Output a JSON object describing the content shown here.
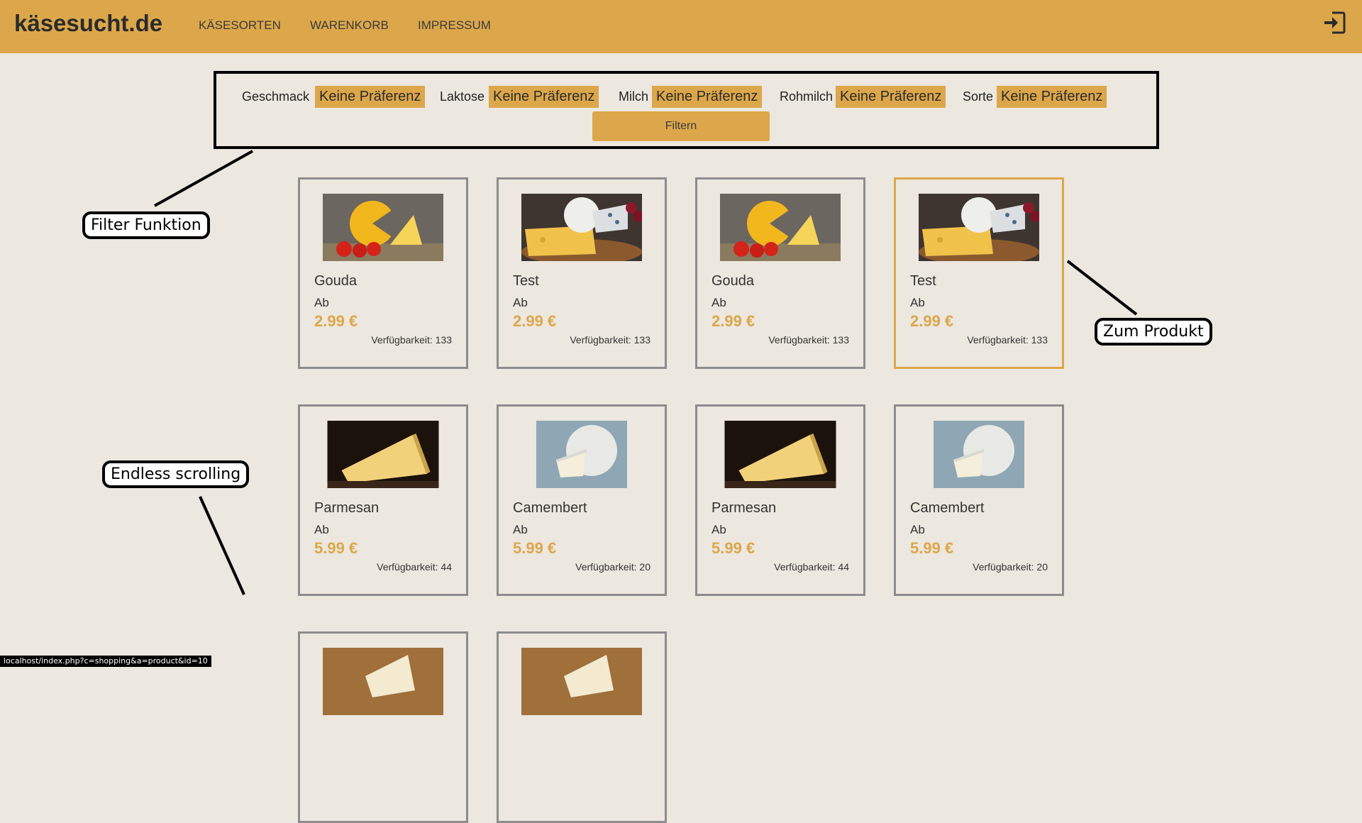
{
  "brand": "käsesucht.de",
  "nav": [
    "KÄSESORTEN",
    "WARENKORB",
    "IMPRESSUM"
  ],
  "filters": [
    {
      "label": "Geschmack",
      "value": "Keine Präferenz"
    },
    {
      "label": "Laktose",
      "value": "Keine Präferenz"
    },
    {
      "label": "Milch",
      "value": "Keine Präferenz"
    },
    {
      "label": "Rohmilch",
      "value": "Keine Präferenz"
    },
    {
      "label": "Sorte",
      "value": "Keine Präferenz"
    }
  ],
  "filter_button": "Filtern",
  "products": [
    {
      "name": "Gouda",
      "ab": "Ab",
      "price": "2.99 €",
      "availability": "Verfügbarkeit: 133"
    },
    {
      "name": "Test",
      "ab": "Ab",
      "price": "2.99 €",
      "availability": "Verfügbarkeit: 133"
    },
    {
      "name": "Gouda",
      "ab": "Ab",
      "price": "2.99 €",
      "availability": "Verfügbarkeit: 133"
    },
    {
      "name": "Test",
      "ab": "Ab",
      "price": "2.99 €",
      "availability": "Verfügbarkeit: 133"
    },
    {
      "name": "Parmesan",
      "ab": "Ab",
      "price": "5.99 €",
      "availability": "Verfügbarkeit: 44"
    },
    {
      "name": "Camembert",
      "ab": "Ab",
      "price": "5.99 €",
      "availability": "Verfügbarkeit: 20"
    },
    {
      "name": "Parmesan",
      "ab": "Ab",
      "price": "5.99 €",
      "availability": "Verfügbarkeit: 44"
    },
    {
      "name": "Camembert",
      "ab": "Ab",
      "price": "5.99 €",
      "availability": "Verfügbarkeit: 20"
    }
  ],
  "annotations": {
    "filter": "Filter Funktion",
    "product": "Zum Produkt",
    "scrolling": "Endless scrolling"
  },
  "status_url": "localhost/index.php?c=shopping&a=product&id=10",
  "colors": {
    "accent": "#dca74a",
    "background": "#ece7df",
    "card_border": "#8c8c8c"
  }
}
